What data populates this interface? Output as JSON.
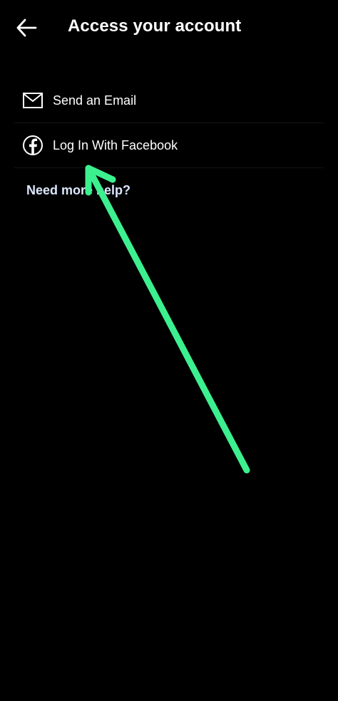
{
  "header": {
    "title": "Access your account",
    "back_icon": "arrow-left-icon"
  },
  "options": [
    {
      "label": "Send an Email",
      "icon": "mail-icon"
    },
    {
      "label": "Log In With Facebook",
      "icon": "facebook-icon"
    }
  ],
  "help": {
    "label": "Need more help?"
  },
  "colors": {
    "background": "#000000",
    "text": "#ffffff",
    "help_text": "#dce8ff",
    "divider": "#141414",
    "annotation_arrow": "#3cf08f"
  }
}
